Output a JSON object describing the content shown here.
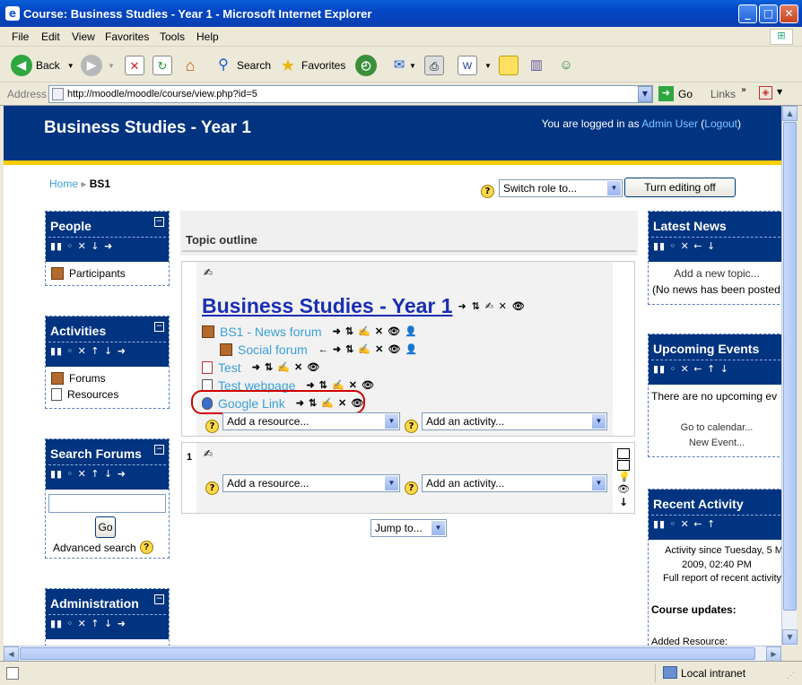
{
  "window": {
    "title": "Course: Business Studies - Year 1 - Microsoft Internet Explorer",
    "minimize": "_",
    "maximize": "□",
    "close": "✕"
  },
  "menu": [
    "File",
    "Edit",
    "View",
    "Favorites",
    "Tools",
    "Help"
  ],
  "toolbar": {
    "back": "Back",
    "search": "Search",
    "favorites": "Favorites"
  },
  "address": {
    "label": "Address",
    "url": "http://moodle/moodle/course/view.php?id=5",
    "go": "Go",
    "links": "Links"
  },
  "page": {
    "course_title": "Business Studies - Year 1",
    "login_prefix": "You are logged in as ",
    "user": "Admin User",
    "logout": "Logout",
    "breadcrumb_home": "Home",
    "breadcrumb_sep": "▸",
    "breadcrumb_current": "BS1",
    "switch_role": "Switch role to...",
    "turn_editing_off": "Turn editing off",
    "topic_outline": "Topic outline",
    "section0_title": "Business Studies - Year 1",
    "activities": [
      {
        "label": "BS1 - News forum"
      },
      {
        "label": "Social forum"
      },
      {
        "label": "Test"
      },
      {
        "label": "Test webpage"
      },
      {
        "label": "Google Link"
      }
    ],
    "add_resource": "Add a resource...",
    "add_activity": "Add an activity...",
    "section1_number": "1",
    "jump_to": "Jump to..."
  },
  "blocks": {
    "people": {
      "title": "People",
      "items": [
        "Participants"
      ]
    },
    "activities": {
      "title": "Activities",
      "items": [
        "Forums",
        "Resources"
      ]
    },
    "search_forums": {
      "title": "Search Forums",
      "go": "Go",
      "advanced": "Advanced search"
    },
    "administration": {
      "title": "Administration"
    },
    "latest_news": {
      "title": "Latest News",
      "add": "Add a new topic...",
      "none": "(No news has been posted"
    },
    "upcoming_events": {
      "title": "Upcoming Events",
      "none": "There are no upcoming ev",
      "calendar": "Go to calendar...",
      "new_event": "New Event..."
    },
    "recent_activity": {
      "title": "Recent Activity",
      "since_line1": "Activity since Tuesday, 5 M",
      "since_line2": "2009, 02:40 PM",
      "full_report": "Full report of recent activity",
      "course_updates": "Course updates:",
      "added": "Added Resource:"
    }
  },
  "status": {
    "zone": "Local intranet"
  },
  "colors": {
    "header_bg": "#003380",
    "header_border": "#ffcc00",
    "link": "#3aa0d8",
    "highlight_ring": "#d00000"
  }
}
